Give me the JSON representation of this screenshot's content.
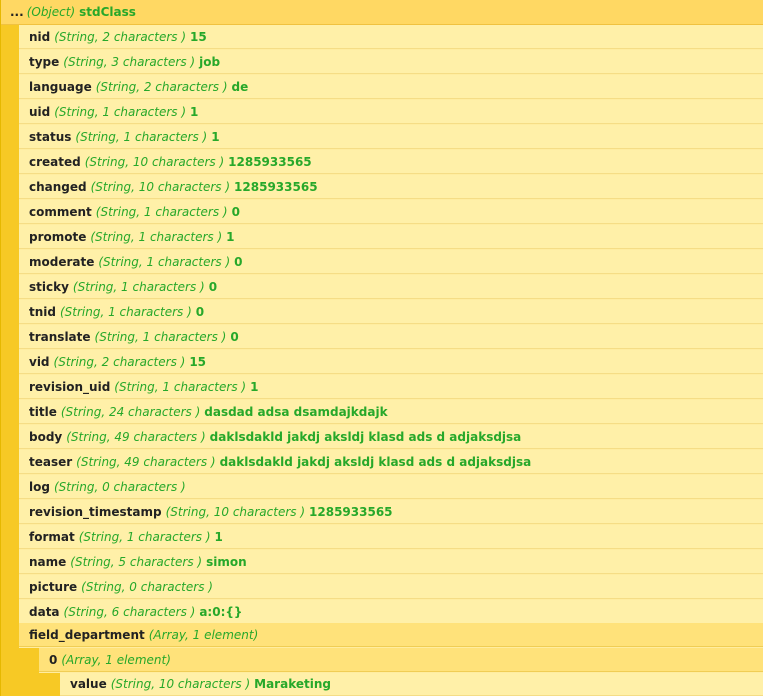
{
  "root": {
    "ellipsis": "...",
    "type": "(Object)",
    "class_name": "stdClass"
  },
  "fields": [
    {
      "key": "nid",
      "type": "(String, 2 characters )",
      "value": "15"
    },
    {
      "key": "type",
      "type": "(String, 3 characters )",
      "value": "job"
    },
    {
      "key": "language",
      "type": "(String, 2 characters )",
      "value": "de"
    },
    {
      "key": "uid",
      "type": "(String, 1 characters )",
      "value": "1"
    },
    {
      "key": "status",
      "type": "(String, 1 characters )",
      "value": "1"
    },
    {
      "key": "created",
      "type": "(String, 10 characters )",
      "value": "1285933565"
    },
    {
      "key": "changed",
      "type": "(String, 10 characters )",
      "value": "1285933565"
    },
    {
      "key": "comment",
      "type": "(String, 1 characters )",
      "value": "0"
    },
    {
      "key": "promote",
      "type": "(String, 1 characters )",
      "value": "1"
    },
    {
      "key": "moderate",
      "type": "(String, 1 characters )",
      "value": "0"
    },
    {
      "key": "sticky",
      "type": "(String, 1 characters )",
      "value": "0"
    },
    {
      "key": "tnid",
      "type": "(String, 1 characters )",
      "value": "0"
    },
    {
      "key": "translate",
      "type": "(String, 1 characters )",
      "value": "0"
    },
    {
      "key": "vid",
      "type": "(String, 2 characters )",
      "value": "15"
    },
    {
      "key": "revision_uid",
      "type": "(String, 1 characters )",
      "value": "1"
    },
    {
      "key": "title",
      "type": "(String, 24 characters )",
      "value": "dasdad adsa dsamdajkdajk"
    },
    {
      "key": "body",
      "type": "(String, 49 characters )",
      "value": "daklsdakld jakdj aksldj klasd ads d adjaksdjsa"
    },
    {
      "key": "teaser",
      "type": "(String, 49 characters )",
      "value": "daklsdakld jakdj aksldj klasd ads d adjaksdjsa"
    },
    {
      "key": "log",
      "type": "(String, 0 characters )",
      "value": ""
    },
    {
      "key": "revision_timestamp",
      "type": "(String, 10 characters )",
      "value": "1285933565"
    },
    {
      "key": "format",
      "type": "(String, 1 characters )",
      "value": "1"
    },
    {
      "key": "name",
      "type": "(String, 5 characters )",
      "value": "simon"
    },
    {
      "key": "picture",
      "type": "(String, 0 characters )",
      "value": ""
    },
    {
      "key": "data",
      "type": "(String, 6 characters )",
      "value": "a:0:{}"
    }
  ],
  "field_department": {
    "key": "field_department",
    "type": "(Array, 1 element)",
    "child": {
      "key": "0",
      "type": "(Array, 1 element)",
      "grandchild": {
        "key": "value",
        "type": "(String, 10 characters )",
        "value": "Maraketing"
      }
    }
  }
}
